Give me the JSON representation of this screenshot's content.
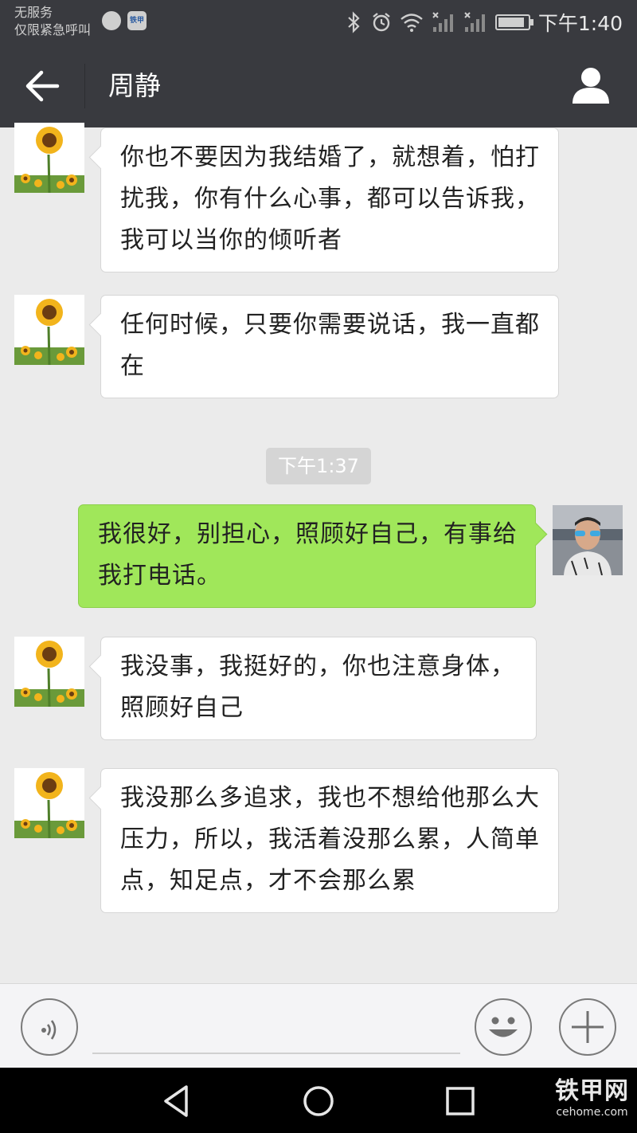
{
  "status_bar": {
    "carrier_line1": "无服务",
    "carrier_line2": "仅限紧急呼叫",
    "app_icon_text": "铁甲",
    "time": "下午1:40"
  },
  "header": {
    "title": "周静"
  },
  "messages": [
    {
      "side": "left",
      "text": "你也不要因为我结婚了，就想着，怕打扰我，你有什么心事，都可以告诉我，我可以当你的倾听者"
    },
    {
      "side": "left",
      "text": "任何时候，只要你需要说话，我一直都在"
    },
    {
      "side": "right",
      "text": "我很好，别担心，照顾好自己，有事给我打电话。"
    },
    {
      "side": "left",
      "text": "我没事，我挺好的，你也注意身体，照顾好自己"
    },
    {
      "side": "left",
      "text": "我没那么多追求，我也不想给他那么大压力，所以，我活着没那么累，人简单点，知足点，才不会那么累"
    }
  ],
  "timestamp": "下午1:37",
  "input": {
    "placeholder": ""
  },
  "watermark": {
    "title": "铁甲网",
    "subtitle": "cehome.com"
  },
  "colors": {
    "header_bg": "#393a3f",
    "chat_bg": "#ebebeb",
    "bubble_sent": "#a0e75a",
    "bubble_received": "#ffffff"
  },
  "icons": [
    "back-arrow-icon",
    "profile-icon",
    "voice-icon",
    "emoji-icon",
    "plus-icon",
    "nav-back-icon",
    "nav-home-icon",
    "nav-recents-icon",
    "bluetooth-icon",
    "alarm-icon",
    "wifi-icon",
    "signal-icon",
    "battery-icon"
  ]
}
